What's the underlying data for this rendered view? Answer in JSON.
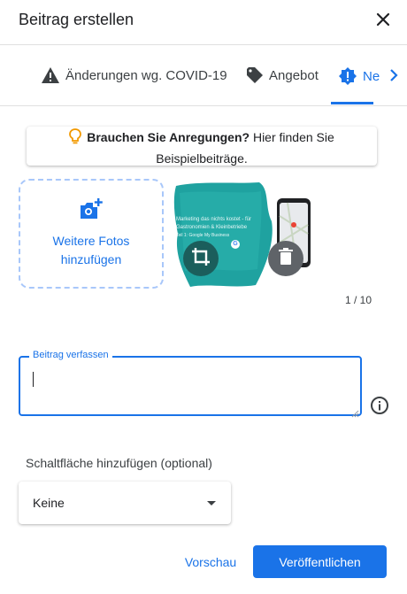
{
  "dialog": {
    "title": "Beitrag erstellen"
  },
  "tabs": [
    {
      "label": "Änderungen wg. COVID-19",
      "icon": "warning-icon"
    },
    {
      "label": "Angebot",
      "icon": "tag-icon"
    },
    {
      "label": "Ne",
      "icon": "news-alert-icon",
      "active": true
    }
  ],
  "tip": {
    "bold": "Brauchen Sie Anregungen?",
    "text": " Hier finden Sie Beispielbeiträge."
  },
  "photos": {
    "add_label": "Weitere Fotos hinzufügen",
    "counter": "1 / 10",
    "thumb_caption_1": "Marketing das nichts kostet - für",
    "thumb_caption_2": "Gastronomien & Kleinbetriebe",
    "thumb_caption_3": "Teil 1: Google My Business"
  },
  "post": {
    "label": "Beitrag verfassen",
    "value": ""
  },
  "cta": {
    "label": "Schaltfläche hinzufügen (optional)",
    "selected": "Keine"
  },
  "actions": {
    "preview": "Vorschau",
    "publish": "Veröffentlichen"
  },
  "colors": {
    "accent": "#1a73e8",
    "tip_bulb": "#f29900",
    "teal": "#1fa2a0"
  }
}
